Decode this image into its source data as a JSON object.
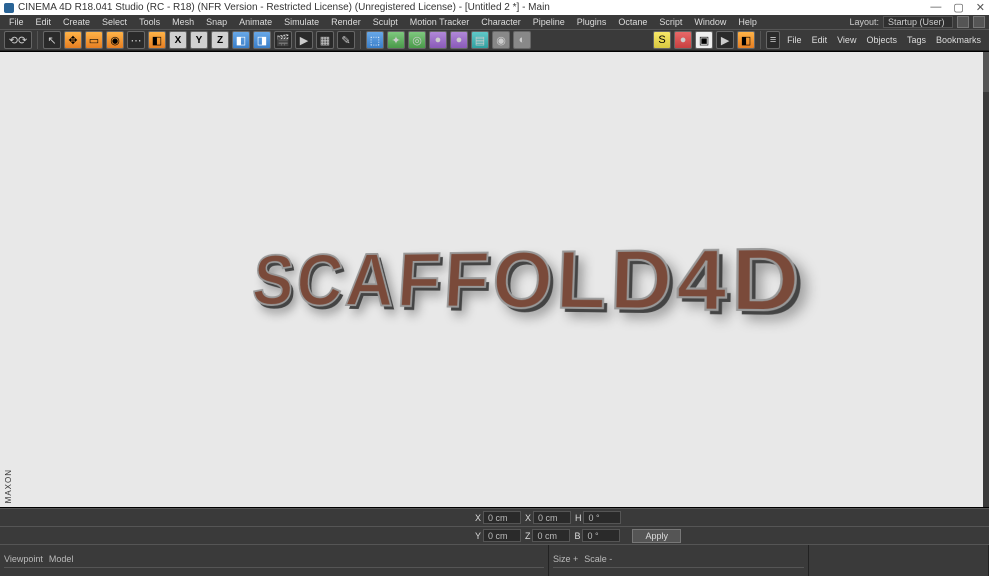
{
  "window": {
    "title": "CINEMA 4D R18.041 Studio (RC - R18) (NFR Version - Restricted License) (Unregistered License) - [Untitled 2 *] - Main",
    "controls": {
      "min": "—",
      "max": "▢",
      "close": "✕"
    }
  },
  "menubar": {
    "items": [
      "File",
      "Edit",
      "Create",
      "Select",
      "Tools",
      "Mesh",
      "Snap",
      "Animate",
      "Simulate",
      "Render",
      "Sculpt",
      "Motion Tracker",
      "Character",
      "Pipeline",
      "Plugins",
      "Octane",
      "Script",
      "Window",
      "Help"
    ],
    "layout_label": "Layout:",
    "layout_value": "Startup (User)"
  },
  "toolbar": {
    "arrow_icon": "↖",
    "move_icon": "✥",
    "rect_icon": "▭",
    "rot_icon": "◉",
    "cube_icon": "◧",
    "axes": [
      "X",
      "Y",
      "Z"
    ],
    "misc_cubes": [
      "◧",
      "◨",
      "◩"
    ],
    "clap_icon": "🎬",
    "arrow_r": "▶",
    "picture_icon": "▦",
    "pencil_icon": "✎",
    "box_icon": "⬚",
    "wrench_icon": "✦",
    "ring_icon": "◎",
    "sphere_icon": "●",
    "grid_icon": "▤",
    "cog_icon": "✲",
    "cam_icon": "◉",
    "bulb_icon": "◐",
    "octane_s": "S",
    "octane_o": "●",
    "octane_cube": "▣",
    "octane_play": "▶",
    "octane_square": "◧"
  },
  "objects_panel": {
    "items": [
      "File",
      "Edit",
      "View",
      "Objects",
      "Tags",
      "Bookmarks"
    ]
  },
  "viewport": {
    "render_text": "SCAFFOLD4D",
    "watermark": "MAXON"
  },
  "coords": {
    "row1": [
      {
        "l": "X",
        "v": "0 cm"
      },
      {
        "l": "X",
        "v": "0 cm"
      },
      {
        "l": "H",
        "v": "0 °"
      }
    ],
    "row2": [
      {
        "l": "Y",
        "v": "0 cm"
      },
      {
        "l": "Z",
        "v": "0 cm"
      },
      {
        "l": "B",
        "v": "0 °"
      }
    ],
    "apply": "Apply"
  },
  "bottom": {
    "left_tabs": [
      "Viewpoint",
      "Model"
    ],
    "mid_tabs": [
      "Size   +",
      "Scale   -"
    ]
  }
}
